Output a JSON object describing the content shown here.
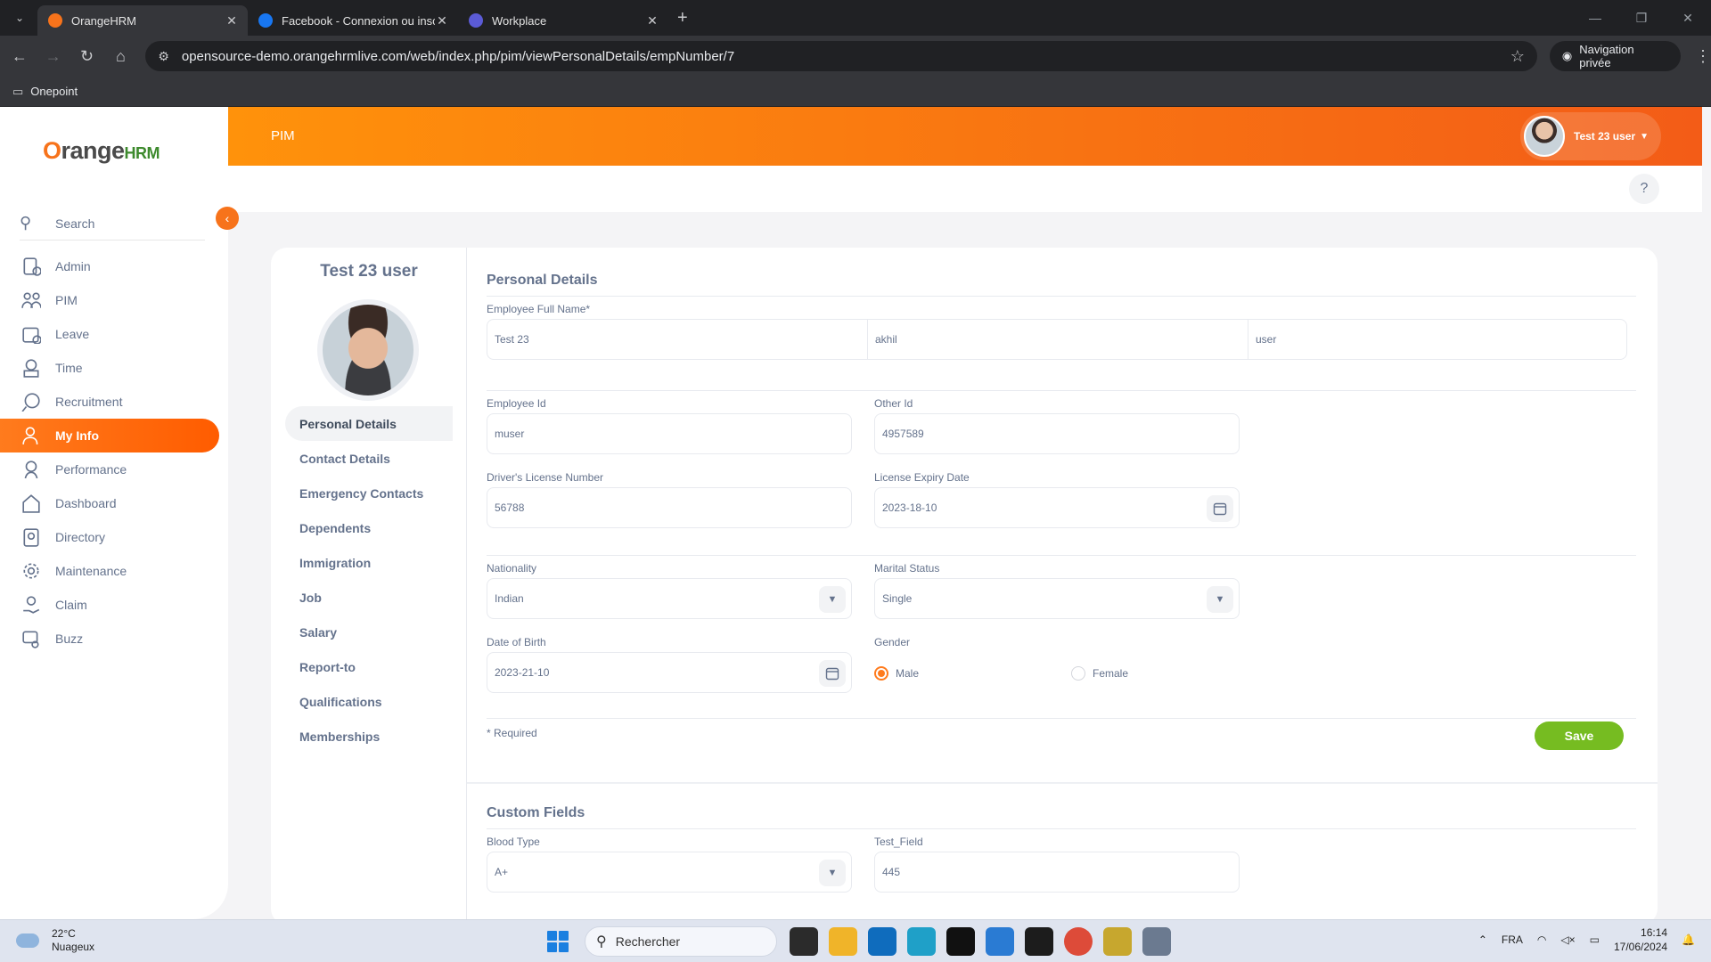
{
  "browser": {
    "tabs": [
      {
        "title": "OrangeHRM",
        "color": "#f7731b"
      },
      {
        "title": "Facebook - Connexion ou inscri",
        "color": "#1877f2"
      },
      {
        "title": "Workplace",
        "color": "#5b5bd6"
      }
    ],
    "url": "opensource-demo.orangehrmlive.com/web/index.php/pim/viewPersonalDetails/empNumber/7",
    "private_label": "Navigation privée",
    "bookmark": "Onepoint"
  },
  "app": {
    "logo_o": "O",
    "logo_range": "range",
    "logo_hrm": "HRM",
    "module": "PIM",
    "user_name": "Test 23 user",
    "search_label": "Search",
    "help": "?",
    "menu": [
      {
        "label": "Admin",
        "icon": "admin-icon"
      },
      {
        "label": "PIM",
        "icon": "pim-icon"
      },
      {
        "label": "Leave",
        "icon": "leave-icon"
      },
      {
        "label": "Time",
        "icon": "time-icon"
      },
      {
        "label": "Recruitment",
        "icon": "recruitment-icon"
      },
      {
        "label": "My Info",
        "icon": "myinfo-icon"
      },
      {
        "label": "Performance",
        "icon": "performance-icon"
      },
      {
        "label": "Dashboard",
        "icon": "dashboard-icon"
      },
      {
        "label": "Directory",
        "icon": "directory-icon"
      },
      {
        "label": "Maintenance",
        "icon": "maintenance-icon"
      },
      {
        "label": "Claim",
        "icon": "claim-icon"
      },
      {
        "label": "Buzz",
        "icon": "buzz-icon"
      }
    ]
  },
  "employee": {
    "name": "Test 23 user",
    "tabs": [
      "Personal Details",
      "Contact Details",
      "Emergency Contacts",
      "Dependents",
      "Immigration",
      "Job",
      "Salary",
      "Report-to",
      "Qualifications",
      "Memberships"
    ]
  },
  "personal": {
    "heading": "Personal Details",
    "full_name_label": "Employee Full Name*",
    "first_name": "Test 23",
    "middle_name": "akhil",
    "last_name": "user",
    "employee_id_label": "Employee Id",
    "employee_id": "muser",
    "other_id_label": "Other Id",
    "other_id": "4957589",
    "license_label": "Driver's License Number",
    "license": "56788",
    "license_expiry_label": "License Expiry Date",
    "license_expiry": "2023-18-10",
    "nationality_label": "Nationality",
    "nationality": "Indian",
    "marital_label": "Marital Status",
    "marital": "Single",
    "dob_label": "Date of Birth",
    "dob": "2023-21-10",
    "gender_label": "Gender",
    "gender_male": "Male",
    "gender_female": "Female",
    "gender_selected": "Male",
    "required_note": "* Required",
    "save": "Save"
  },
  "custom": {
    "heading": "Custom Fields",
    "blood_label": "Blood Type",
    "blood": "A+",
    "test_label": "Test_Field",
    "test": "445"
  },
  "taskbar": {
    "temp": "22°C",
    "weather": "Nuageux",
    "search": "Rechercher",
    "lang": "FRA",
    "time": "16:14",
    "date": "17/06/2024"
  }
}
